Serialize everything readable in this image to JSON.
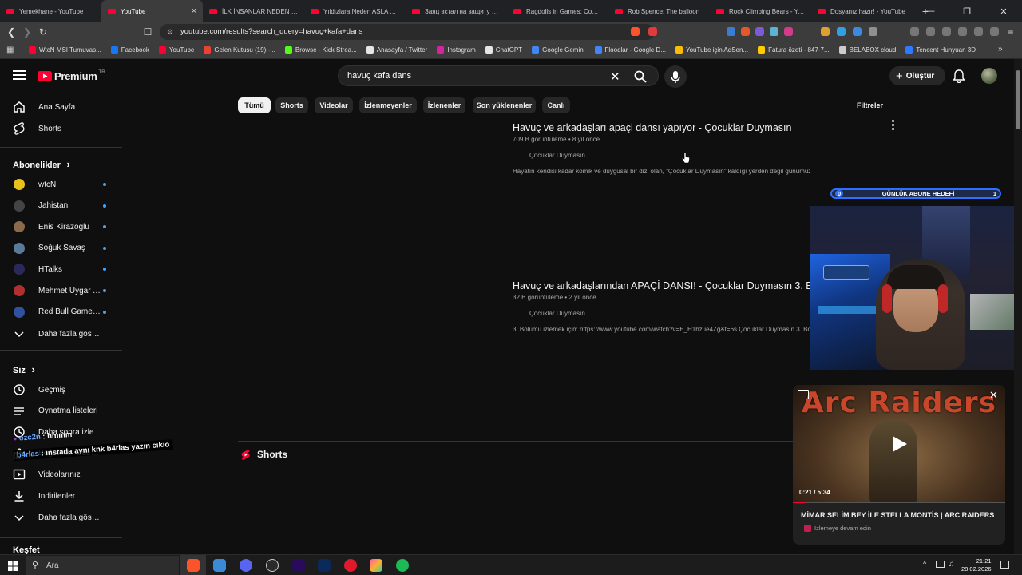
{
  "browser": {
    "tabs": [
      {
        "title": "Yemekhane - YouTube",
        "active": false
      },
      {
        "title": "YouTube",
        "active": true
      },
      {
        "title": "İLK İNSANLAR NEDEN BÖYLE",
        "active": false
      },
      {
        "title": "Yıldızlara Neden ASLA Gidemeyiz",
        "active": false
      },
      {
        "title": "Заяц встал на защиту друга",
        "active": false
      },
      {
        "title": "Ragdolls in Games: Complete",
        "active": false
      },
      {
        "title": "Rob Spence: The balloon",
        "active": false
      },
      {
        "title": "Rock Climbing Bears - YouTube",
        "active": false
      },
      {
        "title": "Dosyanız hazır! - YouTube",
        "active": false
      }
    ],
    "url": "youtube.com/results?search_query=havuç+kafa+dans",
    "bookmarks": [
      {
        "label": "WtcN MSI Turnuvas...",
        "color": "#ff0033"
      },
      {
        "label": "Facebook",
        "color": "#1877f2"
      },
      {
        "label": "YouTube",
        "color": "#ff0033"
      },
      {
        "label": "Gelen Kutusu (19) -...",
        "color": "#ea4335"
      },
      {
        "label": "Browse - Kick Strea...",
        "color": "#53fc18"
      },
      {
        "label": "Anasayfa / Twitter",
        "color": "#e6e6e6"
      },
      {
        "label": "Instagram",
        "color": "#d6249f"
      },
      {
        "label": "ChatGPT",
        "color": "#e6e6e6"
      },
      {
        "label": "Google Gemini",
        "color": "#4285f4"
      },
      {
        "label": "Floodlar - Google D...",
        "color": "#4285f4"
      },
      {
        "label": "YouTube için AdSen...",
        "color": "#fbbc05"
      },
      {
        "label": "Fatura özeti - 847-7...",
        "color": "#ffcc00"
      },
      {
        "label": "BELABOX cloud",
        "color": "#cccccc"
      },
      {
        "label": "Tencent Hunyuan 3D",
        "color": "#2f7bff"
      }
    ]
  },
  "header": {
    "logo_text": "Premium",
    "logo_badge": "TR",
    "search_query": "havuç kafa dans",
    "create_label": "Oluştur"
  },
  "sidebar": {
    "main": [
      {
        "label": "Ana Sayfa",
        "icon": "home-icon"
      },
      {
        "label": "Shorts",
        "icon": "shorts-icon"
      }
    ],
    "subscriptions_title": "Abonelikler",
    "subscriptions": [
      {
        "label": "wtcN",
        "color": "#e8c21a"
      },
      {
        "label": "Jahistan",
        "color": "#444444"
      },
      {
        "label": "Enis Kirazoglu",
        "color": "#8a6a4a"
      },
      {
        "label": "Soğuk Savaş",
        "color": "#5a7a9a"
      },
      {
        "label": "HTalks",
        "color": "#2a2a5a"
      },
      {
        "label": "Mehmet Uygar A...",
        "color": "#b03030"
      },
      {
        "label": "Red Bull Gamers...",
        "color": "#3050a0"
      }
    ],
    "more_label": "Daha fazla göster",
    "you_title": "Siz",
    "you_items": [
      {
        "label": "Geçmiş",
        "icon": "history-icon"
      },
      {
        "label": "Oynatma listeleri",
        "icon": "playlist-icon"
      },
      {
        "label": "Daha sonra izle",
        "icon": "clock-icon"
      },
      {
        "label": "Beğenilen videolar",
        "icon": "like-icon"
      },
      {
        "label": "Videolarınız",
        "icon": "your-videos-icon"
      },
      {
        "label": "İndirilenler",
        "icon": "download-icon"
      }
    ],
    "more_label_2": "Daha fazla göster",
    "explore_title": "Keşfet"
  },
  "filters": {
    "chips": [
      "Tümü",
      "Shorts",
      "Videolar",
      "İzlenmeyenler",
      "İzlenenler",
      "Son yüklenenler",
      "Canlı"
    ],
    "active_index": 0,
    "filters_label": "Filtreler"
  },
  "results": [
    {
      "title": "Havuç ve arkadaşları apaçi dansı yapıyor - Çocuklar Duymasın",
      "views": "709 B görüntüleme",
      "age": "8 yıl önce",
      "channel": "Çocuklar Duymasın",
      "description": "Hayatın kendisi kadar komik ve duygusal bir dizi olan, \"Çocuklar Duymasın\" kaldığı yerden değil günümüzden devam ediyor."
    },
    {
      "title": "Havuç ve arkadaşlarından APAÇİ DANSI! - Çocuklar Duymasın 3. Bölüm",
      "views": "32 B görüntüleme",
      "age": "2 yıl önce",
      "channel": "Çocuklar Duymasın",
      "description": "3. Bölümü izlemek için: https://www.youtube.com/watch?v=E_H1hzue4Zg&t=6s Çocuklar Duymasın 3. Bölüm"
    }
  ],
  "shorts_section_title": "Shorts",
  "stream_overlay": {
    "goal_label": "GÜNLÜK ABONE HEDEFİ",
    "goal_current": "0",
    "goal_target": "1",
    "chat": [
      {
        "user": "ozc2n",
        "message": "hmmm"
      },
      {
        "user": "b4rlas",
        "message": "instada aynı knk b4rlas yazın cıkıo"
      }
    ]
  },
  "miniplayer": {
    "video_title_overlay": "Arc Raiders",
    "time": "0:21 / 5:34",
    "progress": 0.063,
    "title": "MİMAR SELİM BEY İLE STELLA MONTİS | ARC RAIDERS",
    "subtitle": "İzlemeye devam edin"
  },
  "taskbar": {
    "search_placeholder": "Ara",
    "time": "21:21",
    "date": "28.02.2026"
  }
}
